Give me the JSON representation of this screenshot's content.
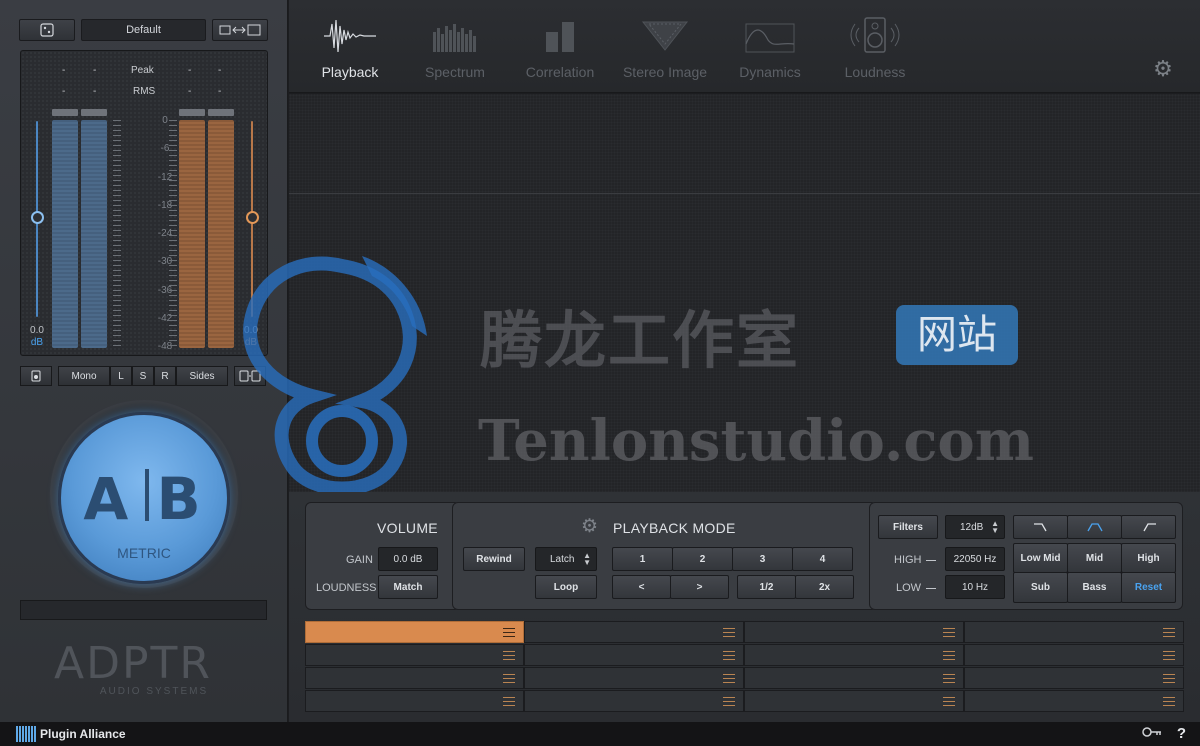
{
  "left": {
    "top_buttons": {
      "default_label": "Default"
    },
    "meter": {
      "peak_label": "Peak",
      "rms_label": "RMS",
      "peak_values": [
        "-",
        "-",
        "-",
        "-"
      ],
      "rms_values": [
        "-",
        "-",
        "-",
        "-"
      ],
      "scale": [
        "0",
        "-6",
        "-12",
        "-18",
        "-24",
        "-30",
        "-36",
        "-42",
        "-48"
      ],
      "left_db_value": "0.0",
      "left_db_unit": "dB",
      "right_db_value": "0.0",
      "right_db_unit": "dB"
    },
    "monitor_buttons": {
      "mono": "Mono",
      "l": "L",
      "s": "S",
      "r": "R",
      "sides": "Sides"
    },
    "ab": {
      "a": "A",
      "b": "B",
      "metric": "METRIC"
    },
    "logo": {
      "main": "ADPTR",
      "sub": "AUDIO SYSTEMS"
    }
  },
  "tabs": [
    {
      "label": "Playback",
      "icon": "waveform-icon",
      "active": true
    },
    {
      "label": "Spectrum",
      "icon": "spectrum-icon",
      "active": false
    },
    {
      "label": "Correlation",
      "icon": "correlation-icon",
      "active": false
    },
    {
      "label": "Stereo Image",
      "icon": "stereo-image-icon",
      "active": false
    },
    {
      "label": "Dynamics",
      "icon": "dynamics-icon",
      "active": false
    },
    {
      "label": "Loudness",
      "icon": "speaker-icon",
      "active": false
    }
  ],
  "watermark": {
    "cn": "腾龙工作室",
    "badge": "网站",
    "en": "Tenlonstudio.com"
  },
  "volume": {
    "title": "VOLUME",
    "gain_label": "GAIN",
    "gain_value": "0.0 dB",
    "loudness_label": "LOUDNESS",
    "match_label": "Match"
  },
  "playback": {
    "title": "PLAYBACK MODE",
    "rewind": "Rewind",
    "latch": "Latch",
    "loop": "Loop",
    "loops": [
      "1",
      "2",
      "3",
      "4"
    ],
    "prev": "<",
    "next": ">",
    "half": "1/2",
    "double": "2x"
  },
  "filters": {
    "filters_label": "Filters",
    "slope": "12dB",
    "high_label": "HIGH",
    "high_value": "22050 Hz",
    "low_label": "LOW",
    "low_value": "10 Hz",
    "bands_row1": [
      "Low Mid",
      "Mid",
      "High"
    ],
    "bands_row2": [
      "Sub",
      "Bass",
      "Reset"
    ]
  },
  "footer": {
    "brand": "Plugin Alliance",
    "help": "?"
  },
  "colors": {
    "accent_blue": "#4aa3f0",
    "accent_orange": "#d98a4e"
  }
}
